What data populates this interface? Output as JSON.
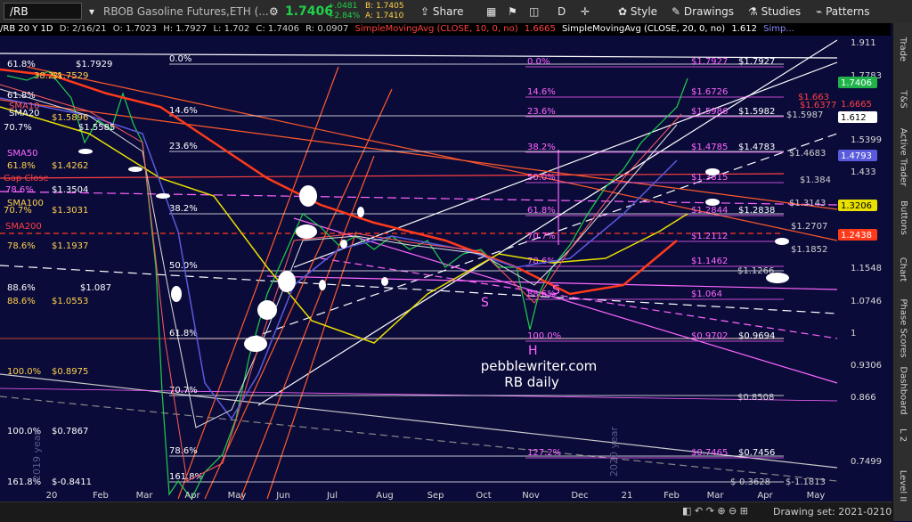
{
  "toolbar": {
    "symbol": "/RB",
    "instrument": "RBOB Gasoline Futures,ETH (...",
    "last_price": "1.7406",
    "change": "+.0481",
    "change_pct": "+2.84%",
    "bid": "B: 1.7405",
    "ask": "A: 1.7410",
    "share_label": "Share",
    "d_label": "D",
    "style_label": "Style",
    "drawings_label": "Drawings",
    "studies_label": "Studies",
    "patterns_label": "Patterns"
  },
  "subheader": {
    "title": "/RB 20 Y 1D",
    "date": "D: 2/16/21",
    "open": "O: 1.7023",
    "high": "H: 1.7927",
    "low": "L: 1.702",
    "close": "C: 1.7406",
    "range": "R: 0.0907",
    "sma10": "SimpleMovingAvg (CLOSE, 10, 0, no)",
    "sma10_val": "1.6665",
    "sma20": "SimpleMovingAvg (CLOSE, 20, 0, no)",
    "sma20_val": "1.612",
    "sma_more": "Simp..."
  },
  "right_tabs": [
    "Trade",
    "T&S",
    "Active Trader",
    "Buttons",
    "Chart",
    "Phase Scores",
    "Dashboard",
    "L 2",
    "Level II"
  ],
  "bottombar": {
    "drawing_set": "Drawing set: 2021-0210"
  },
  "watermark": {
    "site": "pebblewriter.com",
    "subtitle": "RB daily"
  },
  "chart_data": {
    "type": "line",
    "title": "/RB 20 Y 1D",
    "ylim": [
      -0.363,
      1.93
    ],
    "y_ticks": [
      "1.911",
      "1.7783",
      "1.5399",
      "1.433",
      "1.1548",
      "1.0746",
      "1",
      "0.9306",
      "0.866",
      "0.7499"
    ],
    "x_ticks": [
      "20",
      "Feb",
      "Mar",
      "Apr",
      "May",
      "Jun",
      "Jul",
      "Aug",
      "Sep",
      "Oct",
      "Nov",
      "Dec",
      "21",
      "Feb",
      "Mar",
      "Apr",
      "May"
    ],
    "price_tags": [
      {
        "label": "1.7406",
        "color": "#1fb34a",
        "text_color": "#ffffff"
      },
      {
        "label": "1.6665",
        "color": "#0b0b3a",
        "text_color": "#ff4040"
      },
      {
        "label": "1.612",
        "color": "#ffffff",
        "text_color": "#000000"
      },
      {
        "label": "1.4793",
        "color": "#5a5adc",
        "text_color": "#ffffff"
      },
      {
        "label": "1.3206",
        "color": "#e8e000",
        "text_color": "#000000"
      },
      {
        "label": "1.2438",
        "color": "#ff3a1a",
        "text_color": "#ffffff"
      }
    ],
    "left_labels": [
      {
        "text": "61.8%",
        "color": "#ffffff"
      },
      {
        "text": "38.2%",
        "color": "#ffd24a"
      },
      {
        "text": "$1.7929",
        "color": "#ffffff"
      },
      {
        "text": "$1.7529",
        "color": "#ffd24a"
      },
      {
        "text": "61.8%",
        "color": "#ffffff"
      },
      {
        "text": "SMA10",
        "color": "#ff5a5a"
      },
      {
        "text": "SMA20",
        "color": "#ffffff"
      },
      {
        "text": "$1.5896",
        "color": "#ffd24a"
      },
      {
        "text": "70.7%",
        "color": "#ffffff"
      },
      {
        "text": "$1.5585",
        "color": "#ffffff"
      },
      {
        "text": "SMA50",
        "color": "#ff66ff"
      },
      {
        "text": "61.8%",
        "color": "#ffd24a"
      },
      {
        "text": "$1.4262",
        "color": "#ffd24a"
      },
      {
        "text": "Gap Close",
        "color": "#ff4040"
      },
      {
        "text": "78.6%",
        "color": "#ff66ff"
      },
      {
        "text": "$1.3504",
        "color": "#ffffff"
      },
      {
        "text": "SMA100",
        "color": "#ffd24a"
      },
      {
        "text": "70.7%",
        "color": "#ffd24a"
      },
      {
        "text": "$1.3031",
        "color": "#ffd24a"
      },
      {
        "text": "SMA200",
        "color": "#ff4040"
      },
      {
        "text": "78.6%",
        "color": "#ffd24a"
      },
      {
        "text": "$1.1937",
        "color": "#ffd24a"
      },
      {
        "text": "88.6%",
        "color": "#ffffff"
      },
      {
        "text": "$1.087",
        "color": "#ffffff"
      },
      {
        "text": "88.6%",
        "color": "#ffd24a"
      },
      {
        "text": "$1.0553",
        "color": "#ffd24a"
      },
      {
        "text": "100.0%",
        "color": "#ffd24a"
      },
      {
        "text": "$0.8975",
        "color": "#ffd24a"
      },
      {
        "text": "100.0%",
        "color": "#ffffff"
      },
      {
        "text": "$0.7867",
        "color": "#ffffff"
      },
      {
        "text": "161.8%",
        "color": "#ffffff"
      },
      {
        "text": "$-0.8411",
        "color": "#ffffff"
      }
    ],
    "fib_white": [
      "0.0%",
      "14.6%",
      "23.6%",
      "38.2%",
      "50.0%",
      "61.8%",
      "70.7%",
      "78.6%",
      "161.8%"
    ],
    "fib_magenta": [
      {
        "pct": "0.0%",
        "price": "$1.7927",
        "alt": "$1.7927"
      },
      {
        "pct": "14.6%",
        "price": "$1.6726",
        "alt": ""
      },
      {
        "pct": "23.6%",
        "price": "$1.5986",
        "alt": "$1.5982"
      },
      {
        "pct": "38.2%",
        "price": "$1.4785",
        "alt": "$1.4783"
      },
      {
        "pct": "50.0%",
        "price": "$1.3815",
        "alt": ""
      },
      {
        "pct": "61.8%",
        "price": "$1.2844",
        "alt": "$1.2838"
      },
      {
        "pct": "70.7%",
        "price": "$1.2112",
        "alt": ""
      },
      {
        "pct": "78.6%",
        "price": "$1.1462",
        "alt": ""
      },
      {
        "pct": "88.6%",
        "price": "$1.064",
        "alt": ""
      },
      {
        "pct": "100.0%",
        "price": "$0.9702",
        "alt": "$0.9694"
      },
      {
        "pct": "127.2%",
        "price": "$0.7465",
        "alt": "$0.7456"
      }
    ],
    "right_levels": [
      "$1.663",
      "$1.6377",
      "$1.5987",
      "$1.4683",
      "$1.384",
      "$1.3143",
      "$1.2707",
      "$1.1852",
      "$1.1266",
      "$0.8508",
      "$-0.3628",
      "$-1.1813"
    ],
    "annotations": [
      "S",
      "S",
      "H",
      "2019 year",
      "2020 year"
    ]
  }
}
